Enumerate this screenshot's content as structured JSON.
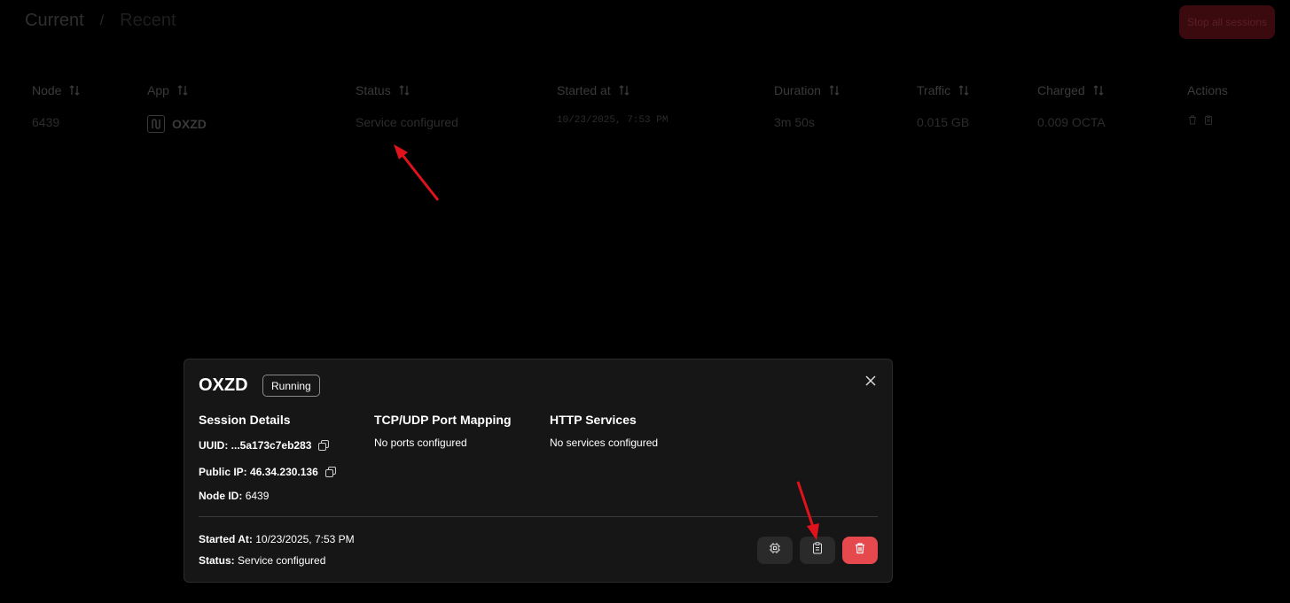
{
  "header": {
    "tab_current": "Current",
    "separator": "/",
    "tab_recent": "Recent",
    "stop_all_label": "Stop all sessions"
  },
  "table": {
    "columns": [
      "Node",
      "App",
      "Status",
      "Started at",
      "Duration",
      "Traffic",
      "Charged",
      "Actions"
    ],
    "rows": [
      {
        "node": "6439",
        "app": "OXZD",
        "status": "Service configured",
        "started_at": "10/23/2025, 7:53 PM",
        "duration": "3m 50s",
        "traffic": "0.015 GB",
        "charged": "0.009 OCTA"
      }
    ]
  },
  "modal": {
    "title": "OXZD",
    "status_badge": "Running",
    "session_details": {
      "heading": "Session Details",
      "uuid_label": "UUID:",
      "uuid_value": "...5a173c7eb283",
      "public_ip_label": "Public IP:",
      "public_ip_value": "46.34.230.136",
      "node_id_label": "Node ID:",
      "node_id_value": "6439"
    },
    "port_mapping": {
      "heading": "TCP/UDP Port Mapping",
      "text": "No ports configured"
    },
    "http_services": {
      "heading": "HTTP Services",
      "text": "No services configured"
    },
    "footer": {
      "started_label": "Started At:",
      "started_value": "10/23/2025, 7:53 PM",
      "status_label": "Status:",
      "status_value": "Service configured"
    }
  },
  "icons": {
    "sort": "sort-icon",
    "close": "close-icon",
    "copy": "copy-icon",
    "chip": "chip-icon",
    "clipboard": "clipboard-icon",
    "trash": "trash-icon"
  },
  "colors": {
    "background": "#000000",
    "modal_bg": "#161616",
    "danger": "#e5484d",
    "annotation_arrow": "#e0121b"
  }
}
